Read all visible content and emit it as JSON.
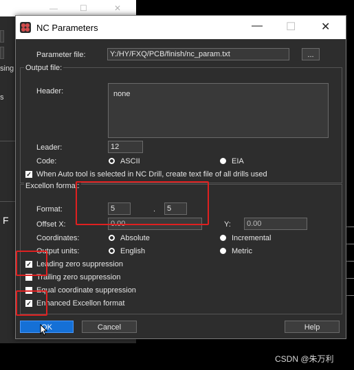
{
  "dialog": {
    "title": "NC Parameters",
    "controls": {
      "minimize": "—",
      "maximize": "☐",
      "close": "✕"
    }
  },
  "parameter_file": {
    "label": "Parameter file:",
    "value": "Y:/HY/FXQ/PCB/finish/nc_param.txt",
    "browse_label": "..."
  },
  "output_file": {
    "group_title": "Output file:",
    "header_label": "Header:",
    "header_value": "none",
    "leader_label": "Leader:",
    "leader_value": "12",
    "code_label": "Code:",
    "code_options": [
      "ASCII",
      "EIA"
    ],
    "code_selected": "ASCII",
    "auto_tool_label": "When Auto tool is selected in NC Drill, create text file of all drills used",
    "auto_tool_checked": true
  },
  "excellon": {
    "group_title": "Excellon format:",
    "format_label": "Format:",
    "format_int": "5",
    "format_sep": ".",
    "format_dec": "5",
    "offset_x_label": "Offset X:",
    "offset_x_value": "0.00",
    "offset_y_label": "Y:",
    "offset_y_value": "0.00",
    "coordinates_label": "Coordinates:",
    "coordinates_options": [
      "Absolute",
      "Incremental"
    ],
    "coordinates_selected": "Absolute",
    "output_units_label": "Output units:",
    "output_units_options": [
      "English",
      "Metric"
    ],
    "output_units_selected": "English"
  },
  "options": [
    {
      "label": "Leading zero suppression",
      "checked": true
    },
    {
      "label": "Trailing zero suppression",
      "checked": false
    },
    {
      "label": "Equal coordinate suppression",
      "checked": false
    },
    {
      "label": "Enhanced Excellon format",
      "checked": true
    }
  ],
  "buttons": {
    "ok": "OK",
    "cancel": "Cancel",
    "help": "Help"
  },
  "background_window": {
    "label_fragment_1": "sing",
    "label_fragment_2": "s",
    "letter": "F"
  },
  "watermark": "CSDN @朱万利",
  "colors": {
    "highlight_box": "#e02020",
    "primary_button": "#1570d6",
    "dialog_bg": "#2d2d2d"
  }
}
